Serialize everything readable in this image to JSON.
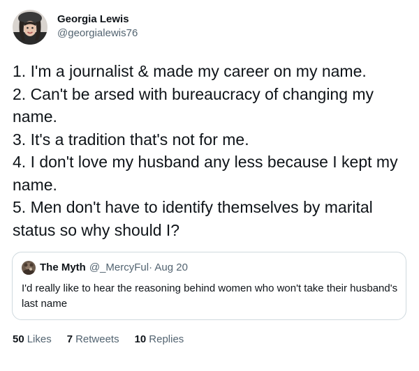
{
  "author": {
    "display_name": "Georgia Lewis",
    "handle": "@georgialewis76",
    "avatar_icon": "profile-photo-icon"
  },
  "tweet": {
    "lines": [
      "1. I'm a journalist & made my career on my name.",
      "2. Can't be arsed with bureaucracy of changing my name.",
      "3. It's a tradition that's not for me.",
      "4. I don't love my husband any less because I kept my name.",
      "5. Men don't have to identify themselves by marital status so why should I?"
    ]
  },
  "quoted_tweet": {
    "display_name": "The Myth",
    "handle": "@_MercyFul",
    "date": "· Aug 20",
    "text": "I'd really like to hear the reasoning behind women who won't take their husband's last name",
    "avatar_icon": "profile-photo-icon"
  },
  "stats": {
    "likes": {
      "count": "50",
      "label": "Likes"
    },
    "retweets": {
      "count": "7",
      "label": "Retweets"
    },
    "replies": {
      "count": "10",
      "label": "Replies"
    }
  },
  "colors": {
    "text": "#0f1419",
    "secondary": "#536471",
    "border": "#cfd9de"
  }
}
